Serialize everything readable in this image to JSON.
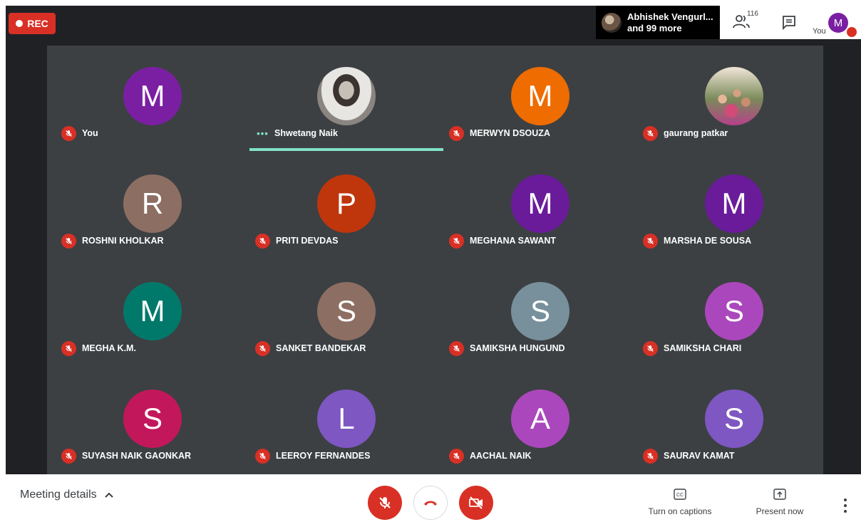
{
  "recording": {
    "label": "REC"
  },
  "active_speaker": {
    "line1": "Abhishek Vengurl...",
    "line2": "and 99 more"
  },
  "topbar": {
    "participant_count": "116",
    "you_label": "You",
    "you_initial": "M"
  },
  "participants": [
    {
      "name": "You",
      "initial": "M",
      "color": "#7b1fa2",
      "muted": true
    },
    {
      "name": "Shwetang Naik",
      "initial": "",
      "color": "#e0e0e0",
      "muted": false,
      "speaking": true,
      "photo": "photo1"
    },
    {
      "name": "MERWYN DSOUZA",
      "initial": "M",
      "color": "#ef6c00",
      "muted": true
    },
    {
      "name": "gaurang patkar",
      "initial": "",
      "color": "#cccccc",
      "muted": true,
      "photo": "photo2"
    },
    {
      "name": "ROSHNI KHOLKAR",
      "initial": "R",
      "color": "#8d6e63",
      "muted": true
    },
    {
      "name": "PRITI DEVDAS",
      "initial": "P",
      "color": "#bf360c",
      "muted": true
    },
    {
      "name": "MEGHANA SAWANT",
      "initial": "M",
      "color": "#6a1b9a",
      "muted": true
    },
    {
      "name": "MARSHA DE SOUSA",
      "initial": "M",
      "color": "#6a1b9a",
      "muted": true
    },
    {
      "name": "MEGHA K.M.",
      "initial": "M",
      "color": "#00796b",
      "muted": true
    },
    {
      "name": "SANKET BANDEKAR",
      "initial": "S",
      "color": "#8d6e63",
      "muted": true
    },
    {
      "name": "SAMIKSHA HUNGUND",
      "initial": "S",
      "color": "#78909c",
      "muted": true
    },
    {
      "name": "SAMIKSHA CHARI",
      "initial": "S",
      "color": "#ab47bc",
      "muted": true
    },
    {
      "name": "SUYASH NAIK GAONKAR",
      "initial": "S",
      "color": "#c2185b",
      "muted": true
    },
    {
      "name": "LEEROY FERNANDES",
      "initial": "L",
      "color": "#7e57c2",
      "muted": true
    },
    {
      "name": "AACHAL NAIK",
      "initial": "A",
      "color": "#ab47bc",
      "muted": true
    },
    {
      "name": "SAURAV KAMAT",
      "initial": "S",
      "color": "#7e57c2",
      "muted": true
    }
  ],
  "bottom": {
    "meeting_details": "Meeting details",
    "captions_label": "Turn on captions",
    "present_label": "Present now"
  },
  "icons": {
    "mic_off": "mic-off-icon",
    "hangup": "call-end-icon",
    "cam_off": "videocam-off-icon",
    "captions": "closed-caption-icon",
    "present": "present-to-all-icon",
    "people": "people-icon",
    "chat": "chat-icon",
    "more": "more-vert-icon"
  }
}
